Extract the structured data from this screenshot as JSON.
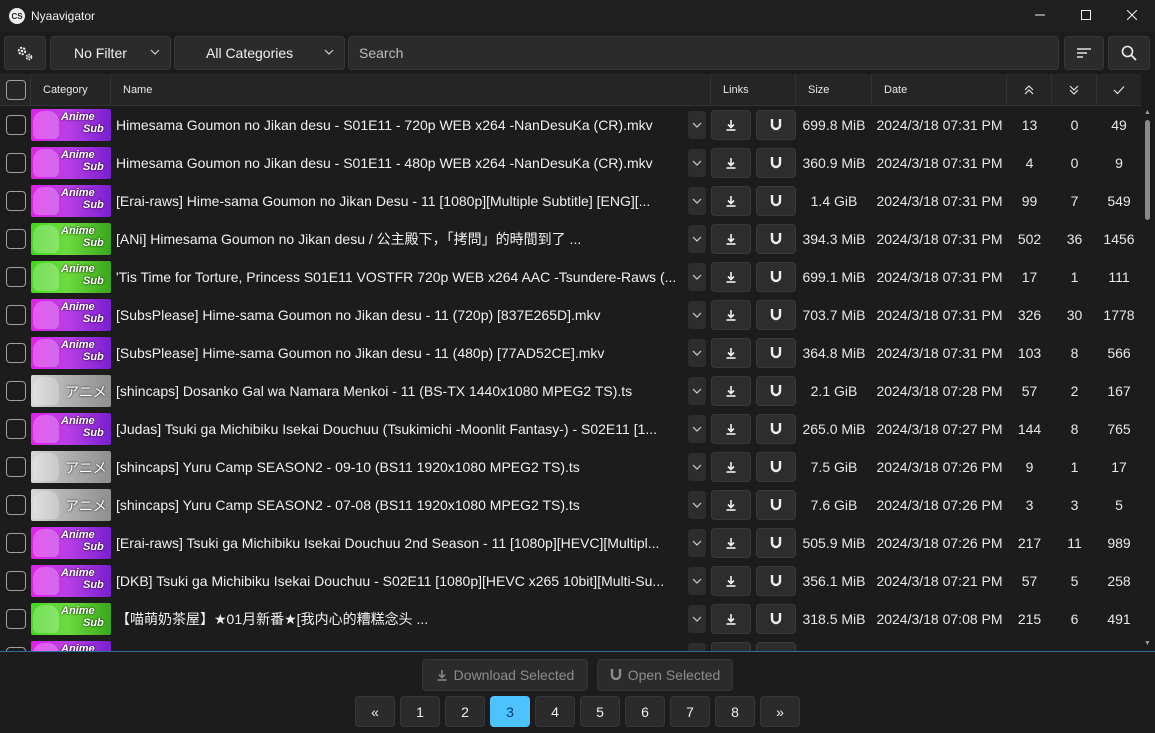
{
  "app": {
    "title": "Nyaavigator",
    "icon_text": "CS"
  },
  "toolbar": {
    "filter": "No Filter",
    "category": "All Categories",
    "search_placeholder": "Search"
  },
  "header": {
    "category": "Category",
    "name": "Name",
    "links": "Links",
    "size": "Size",
    "date": "Date"
  },
  "thumb_labels": {
    "anime": "Anime",
    "sub": "Sub",
    "jp": "アニメ"
  },
  "rows": [
    {
      "thumb": "purple",
      "name": "Himesama Goumon no Jikan desu - S01E11 - 720p WEB x264 -NanDesuKa (CR).mkv",
      "size": "699.8 MiB",
      "date": "2024/3/18 07:31 PM",
      "seeders": "13",
      "leechers": "0",
      "completed": "49"
    },
    {
      "thumb": "purple",
      "name": "Himesama Goumon no Jikan desu - S01E11 - 480p WEB x264 -NanDesuKa (CR).mkv",
      "size": "360.9 MiB",
      "date": "2024/3/18 07:31 PM",
      "seeders": "4",
      "leechers": "0",
      "completed": "9"
    },
    {
      "thumb": "purple",
      "name": "[Erai-raws] Hime-sama Goumon no Jikan Desu - 11 [1080p][Multiple Subtitle] [ENG][...",
      "size": "1.4 GiB",
      "date": "2024/3/18 07:31 PM",
      "seeders": "99",
      "leechers": "7",
      "completed": "549"
    },
    {
      "thumb": "green",
      "name": "[ANi] Himesama Goumon no Jikan desu /  公主殿下，「拷問」的時間到了 ...",
      "size": "394.3 MiB",
      "date": "2024/3/18 07:31 PM",
      "seeders": "502",
      "leechers": "36",
      "completed": "1456"
    },
    {
      "thumb": "green",
      "name": "'Tis Time for Torture, Princess S01E11 VOSTFR 720p WEB x264 AAC -Tsundere-Raws (...",
      "size": "699.1 MiB",
      "date": "2024/3/18 07:31 PM",
      "seeders": "17",
      "leechers": "1",
      "completed": "111"
    },
    {
      "thumb": "purple",
      "name": "[SubsPlease] Hime-sama Goumon no Jikan desu - 11 (720p) [837E265D].mkv",
      "size": "703.7 MiB",
      "date": "2024/3/18 07:31 PM",
      "seeders": "326",
      "leechers": "30",
      "completed": "1778"
    },
    {
      "thumb": "purple",
      "name": "[SubsPlease] Hime-sama Goumon no Jikan desu - 11 (480p) [77AD52CE].mkv",
      "size": "364.8 MiB",
      "date": "2024/3/18 07:31 PM",
      "seeders": "103",
      "leechers": "8",
      "completed": "566"
    },
    {
      "thumb": "gray",
      "name": "[shincaps] Dosanko Gal wa Namara Menkoi - 11 (BS-TX 1440x1080 MPEG2 TS).ts",
      "size": "2.1 GiB",
      "date": "2024/3/18 07:28 PM",
      "seeders": "57",
      "leechers": "2",
      "completed": "167"
    },
    {
      "thumb": "purple",
      "name": "[Judas] Tsuki ga Michibiku Isekai Douchuu (Tsukimichi -Moonlit Fantasy-) - S02E11 [1...",
      "size": "265.0 MiB",
      "date": "2024/3/18 07:27 PM",
      "seeders": "144",
      "leechers": "8",
      "completed": "765"
    },
    {
      "thumb": "gray",
      "name": "[shincaps] Yuru Camp SEASON2 - 09-10 (BS11 1920x1080 MPEG2 TS).ts",
      "size": "7.5 GiB",
      "date": "2024/3/18 07:26 PM",
      "seeders": "9",
      "leechers": "1",
      "completed": "17"
    },
    {
      "thumb": "gray",
      "name": "[shincaps] Yuru Camp SEASON2 - 07-08 (BS11 1920x1080 MPEG2 TS).ts",
      "size": "7.6 GiB",
      "date": "2024/3/18 07:26 PM",
      "seeders": "3",
      "leechers": "3",
      "completed": "5"
    },
    {
      "thumb": "purple",
      "name": "[Erai-raws] Tsuki ga Michibiku Isekai Douchuu 2nd Season - 11 [1080p][HEVC][Multipl...",
      "size": "505.9 MiB",
      "date": "2024/3/18 07:26 PM",
      "seeders": "217",
      "leechers": "11",
      "completed": "989"
    },
    {
      "thumb": "purple",
      "name": "[DKB] Tsuki ga Michibiku Isekai Douchuu - S02E11 [1080p][HEVC x265 10bit][Multi-Su...",
      "size": "356.1 MiB",
      "date": "2024/3/18 07:21 PM",
      "seeders": "57",
      "leechers": "5",
      "completed": "258"
    },
    {
      "thumb": "green",
      "name": "【喵萌奶茶屋】★01月新番★[我内心的糟糕念头 ...",
      "size": "318.5 MiB",
      "date": "2024/3/18 07:08 PM",
      "seeders": "215",
      "leechers": "6",
      "completed": "491"
    },
    {
      "thumb": "purple",
      "name": "",
      "size": "",
      "date": "",
      "seeders": "",
      "leechers": "",
      "completed": ""
    }
  ],
  "footer": {
    "download_selected": "Download Selected",
    "open_selected": "Open Selected",
    "first": "«",
    "last": "»",
    "pages": [
      "1",
      "2",
      "3",
      "4",
      "5",
      "6",
      "7",
      "8"
    ],
    "current_page": "3"
  },
  "colors": {
    "accent": "#4cc2ff",
    "background": "#1c1c1c",
    "purple_thumb": "#c030e8",
    "green_thumb": "#50d020",
    "gray_thumb": "#b0b0b0"
  },
  "icons": {
    "settings": "gear-icon",
    "sort": "sort-icon",
    "search": "search-icon",
    "download": "download-icon",
    "magnet": "magnet-icon",
    "seeders": "double-chevron-up-icon",
    "leechers": "double-chevron-down-icon",
    "completed": "check-icon"
  }
}
